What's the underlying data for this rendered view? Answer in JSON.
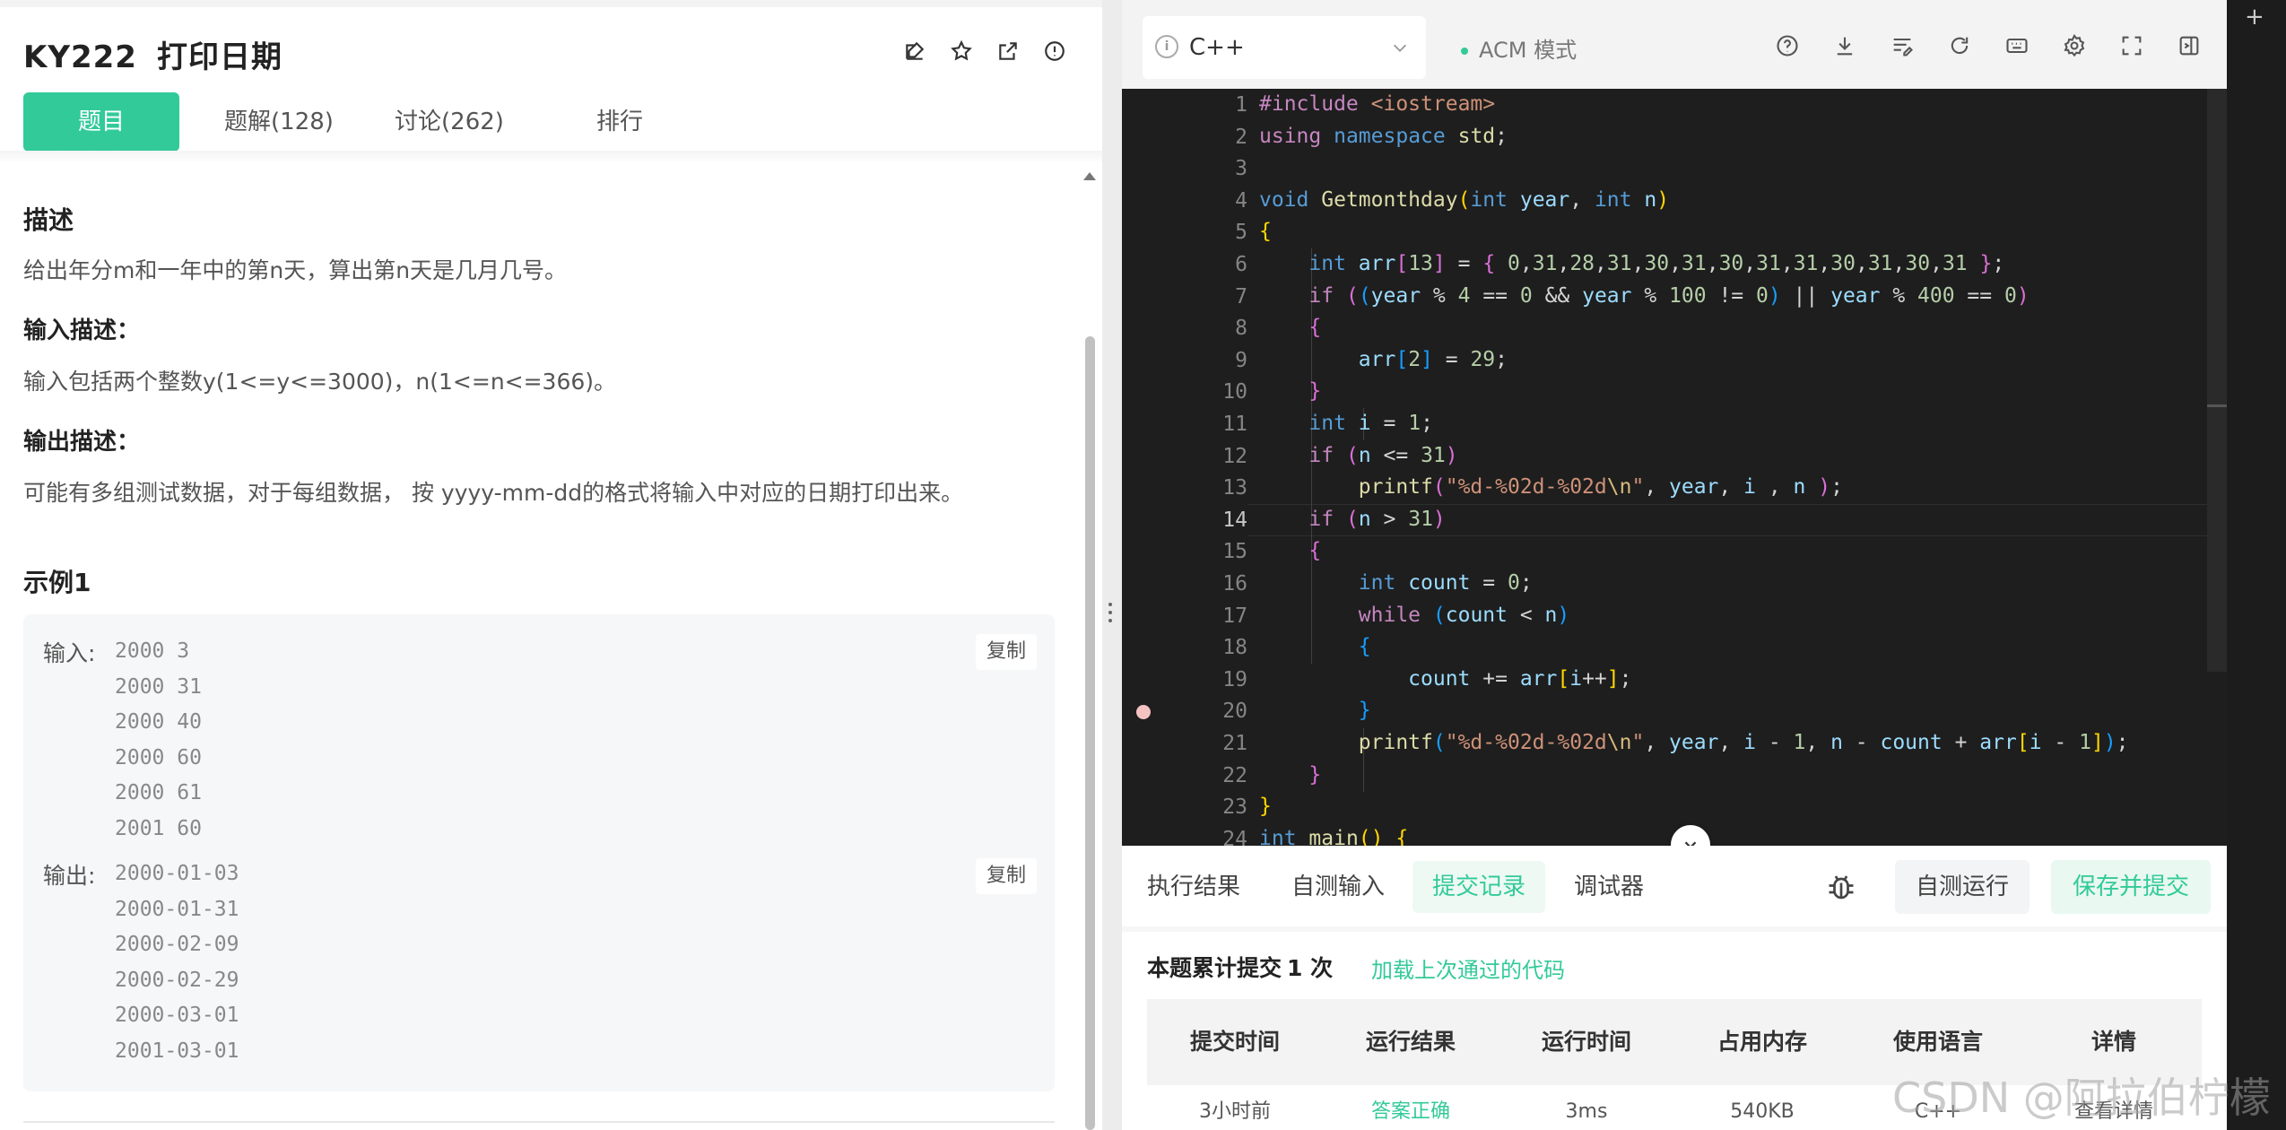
{
  "problem": {
    "id": "KY222",
    "title": "打印日期",
    "tabs": [
      {
        "label": "题目"
      },
      {
        "label": "题解(128)"
      },
      {
        "label": "讨论(262)"
      },
      {
        "label": "排行"
      }
    ],
    "description_heading": "描述",
    "description": "给出年分m和一年中的第n天，算出第n天是几月几号。",
    "input_heading": "输入描述：",
    "input_text": "输入包括两个整数y(1<=y<=3000)，n(1<=n<=366)。",
    "output_heading": "输出描述：",
    "output_text": "可能有多组测试数据，对于每组数据， 按 yyyy-mm-dd的格式将输入中对应的日期打印出来。",
    "example_heading": "示例1",
    "example": {
      "input_label": "输入:",
      "input_lines": [
        "2000 3",
        "2000 31",
        "2000 40",
        "2000 60",
        "2000 61",
        "2001 60"
      ],
      "output_label": "输出:",
      "output_lines": [
        "2000-01-03",
        "2000-01-31",
        "2000-02-09",
        "2000-02-29",
        "2000-03-01",
        "2001-03-01"
      ],
      "copy_label": "复制"
    }
  },
  "editor": {
    "language": "C++",
    "mode": "ACM 模式",
    "current_line": 14,
    "breakpoint_line": 20,
    "line_numbers": [
      "1",
      "2",
      "3",
      "4",
      "5",
      "6",
      "7",
      "8",
      "9",
      "10",
      "11",
      "12",
      "13",
      "14",
      "15",
      "16",
      "17",
      "18",
      "19",
      "20",
      "21",
      "22",
      "23",
      "24"
    ]
  },
  "bottom": {
    "tabs": [
      {
        "label": "执行结果"
      },
      {
        "label": "自测输入"
      },
      {
        "label": "提交记录"
      },
      {
        "label": "调试器"
      }
    ],
    "active_tab": "提交记录",
    "run_label": "自测运行",
    "submit_label": "保存并提交",
    "summary_prefix": "本题累计提交",
    "summary_count": "1 次",
    "load_link": "加载上次通过的代码",
    "table": {
      "headers": [
        "提交时间",
        "运行结果",
        "运行时间",
        "占用内存",
        "使用语言",
        "详情"
      ],
      "rows": [
        [
          "3小时前",
          "答案正确",
          "3ms",
          "540KB",
          "C++",
          "查看详情"
        ]
      ]
    }
  },
  "watermark": "CSDN @阿拉伯柠檬",
  "colors": {
    "accent": "#32ca99",
    "editor_bg": "#1e1e1e"
  }
}
